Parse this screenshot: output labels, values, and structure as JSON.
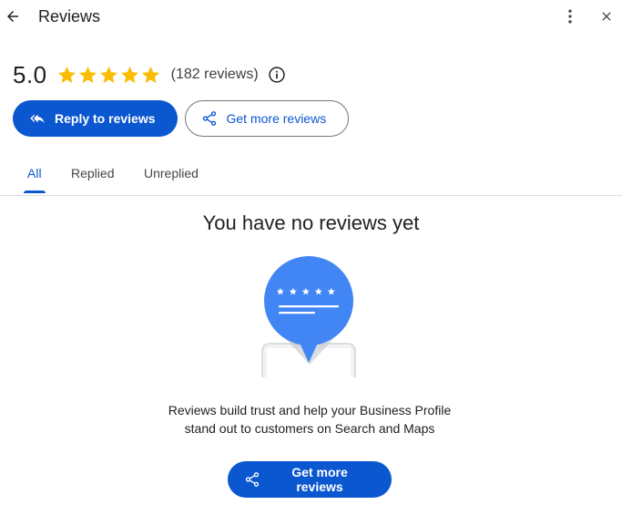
{
  "header": {
    "title": "Reviews",
    "back_icon": "arrow-back-icon",
    "more_icon": "more-vert-icon",
    "close_icon": "close-icon"
  },
  "rating": {
    "value": "5.0",
    "stars": 5,
    "star_color": "#fbbc04",
    "count_text": "(182 reviews)",
    "info_icon": "info-icon"
  },
  "actions": {
    "reply_label": "Reply to reviews",
    "reply_icon": "reply-all-icon",
    "get_more_label": "Get more reviews",
    "share_icon": "share-icon"
  },
  "tabs": [
    {
      "label": "All",
      "active": true
    },
    {
      "label": "Replied",
      "active": false
    },
    {
      "label": "Unreplied",
      "active": false
    }
  ],
  "empty_state": {
    "title": "You have no reviews yet",
    "description_line1": "Reviews build trust and help your Business Profile",
    "description_line2": "stand out to customers on Search and Maps",
    "cta_label": "Get more reviews",
    "illustration": "review-bubble-illustration"
  },
  "colors": {
    "primary": "#0b57d0",
    "illustration_blue": "#4285f4",
    "text": "#202124"
  }
}
